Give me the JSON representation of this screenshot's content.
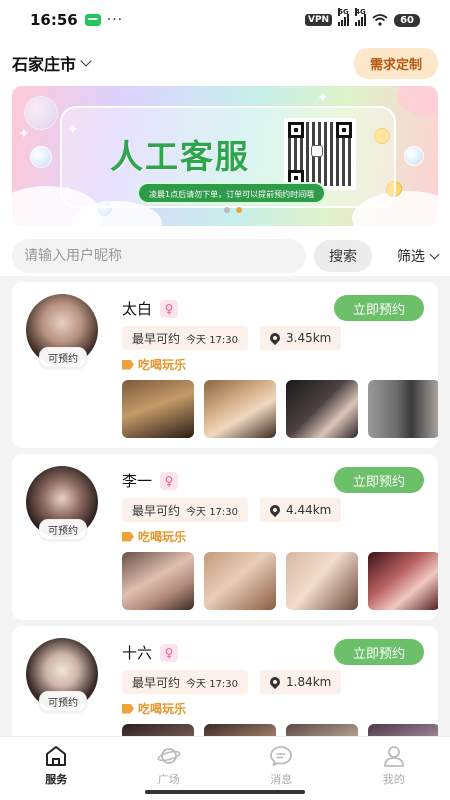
{
  "status_bar": {
    "time": "16:56",
    "dots": "···",
    "vpn": "VPN",
    "net1": "5G",
    "net2": "4G",
    "battery": "60"
  },
  "header": {
    "city": "石家庄市",
    "custom_button": "需求定制"
  },
  "banner": {
    "title": "人工客服",
    "subtitle": "凌晨1点后请勿下单，订单可以提前预约时间哦"
  },
  "search": {
    "placeholder": "请输入用户昵称",
    "button": "搜索",
    "filter": "筛选"
  },
  "cards": [
    {
      "name": "太白",
      "gender": "♀",
      "badge": "可预约",
      "book": "立即预约",
      "earliest_label": "最早可约",
      "earliest_time": "今天 17:30",
      "distance": "3.45km",
      "tag": "吃喝玩乐"
    },
    {
      "name": "李一",
      "gender": "♀",
      "badge": "可预约",
      "book": "立即预约",
      "earliest_label": "最早可约",
      "earliest_time": "今天 17:30",
      "distance": "4.44km",
      "tag": "吃喝玩乐"
    },
    {
      "name": "十六",
      "gender": "♀",
      "badge": "可预约",
      "book": "立即预约",
      "earliest_label": "最早可约",
      "earliest_time": "今天 17:30",
      "distance": "1.84km",
      "tag": "吃喝玩乐"
    }
  ],
  "nav": [
    {
      "label": "服务",
      "icon": "home-icon",
      "active": true
    },
    {
      "label": "广场",
      "icon": "planet-icon",
      "active": false
    },
    {
      "label": "消息",
      "icon": "message-icon",
      "active": false
    },
    {
      "label": "我的",
      "icon": "user-icon",
      "active": false
    }
  ],
  "colors": {
    "accent_green": "#6cc06a",
    "accent_orange": "#f0a23a",
    "custom_bg": "#fde7cb"
  }
}
